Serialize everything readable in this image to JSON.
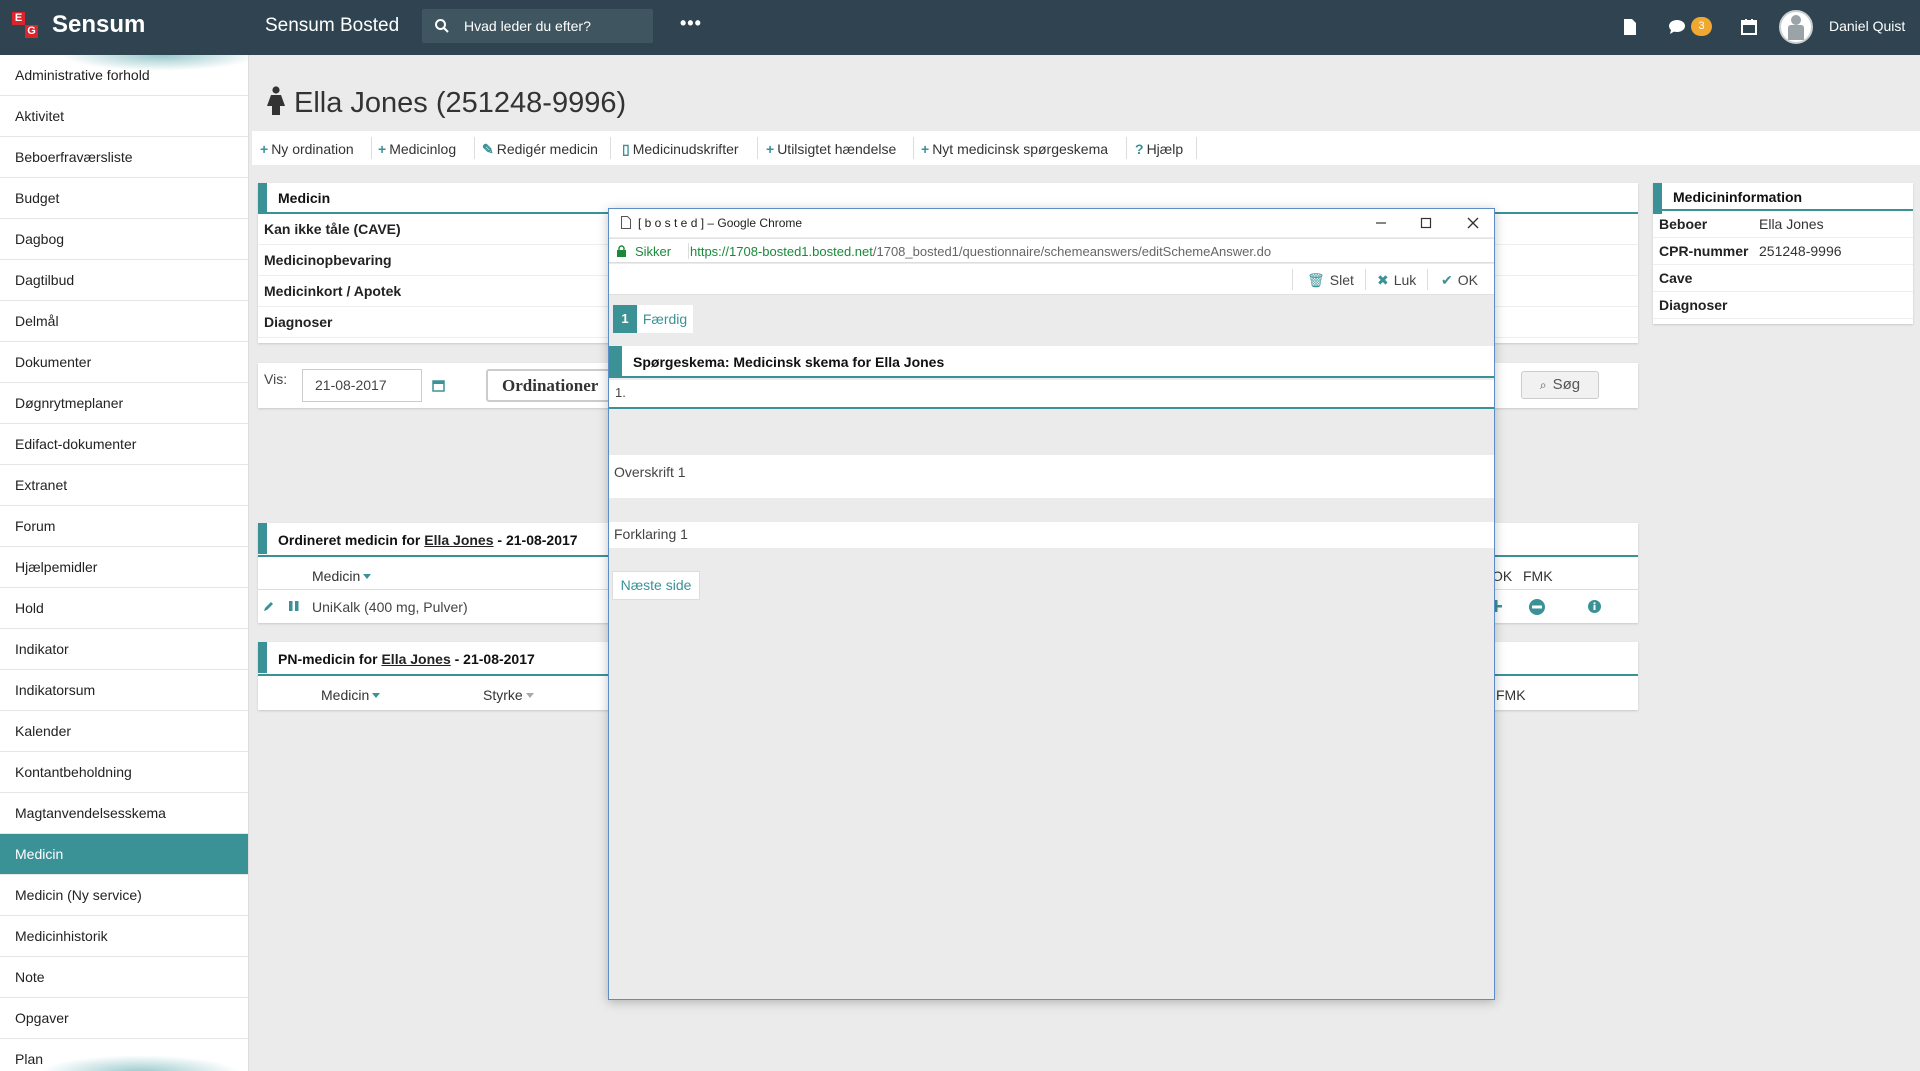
{
  "topbar": {
    "brand": "Sensum",
    "logo_letters": [
      "E",
      "G"
    ],
    "app_title": "Sensum Bosted",
    "search_placeholder": "Hvad leder du efter?",
    "more": "•••",
    "messages_badge": "3",
    "user_name": "Daniel Quist"
  },
  "sidebar": {
    "items": [
      "Administrative forhold",
      "Aktivitet",
      "Beboerfraværsliste",
      "Budget",
      "Dagbog",
      "Dagtilbud",
      "Delmål",
      "Dokumenter",
      "Døgnrytmeplaner",
      "Edifact-dokumenter",
      "Extranet",
      "Forum",
      "Hjælpemidler",
      "Hold",
      "Indikator",
      "Indikatorsum",
      "Kalender",
      "Kontantbeholdning",
      "Magtanvendelsesskema",
      "Medicin",
      "Medicin (Ny service)",
      "Medicinhistorik",
      "Note",
      "Opgaver",
      "Plan"
    ],
    "active_index": 19
  },
  "page": {
    "title": "Ella Jones (251248-9996)"
  },
  "actions": [
    {
      "icon": "+",
      "label": "Ny ordination"
    },
    {
      "icon": "+",
      "label": "Medicinlog"
    },
    {
      "icon": "✎",
      "label": "Redigér medicin"
    },
    {
      "icon": "▯",
      "label": "Medicinudskrifter"
    },
    {
      "icon": "+",
      "label": "Utilsigtet hændelse"
    },
    {
      "icon": "+",
      "label": "Nyt medicinsk spørgeskema"
    },
    {
      "icon": "?",
      "label": "Hjælp"
    }
  ],
  "medicin_panel": {
    "title": "Medicin",
    "rows": [
      "Kan ikke tåle (CAVE)",
      "Medicinopbevaring",
      "Medicinkort / Apotek",
      "Diagnoser"
    ]
  },
  "filter": {
    "vis_label": "Vis:",
    "date": "21-08-2017",
    "ordination_button": "Ordinationer",
    "search_button": "Søg"
  },
  "ordineret": {
    "title_prefix": "Ordineret medicin for",
    "person": "Ella Jones",
    "title_suffix": "- 21-08-2017",
    "col_medicin": "Medicin",
    "col_ok": "OK",
    "col_fmk": "FMK",
    "row_medicin": "UniKalk (400 mg, Pulver)"
  },
  "pn": {
    "title_prefix": "PN-medicin for",
    "person": "Ella Jones",
    "title_suffix": "- 21-08-2017",
    "col_medicin": "Medicin",
    "col_styrke": "Styrke",
    "col_fmk": "FMK"
  },
  "info_panel": {
    "title": "Medicininformation",
    "rows": [
      {
        "k": "Beboer",
        "v": "Ella Jones"
      },
      {
        "k": "CPR-nummer",
        "v": "251248-9996"
      },
      {
        "k": "Cave",
        "v": ""
      },
      {
        "k": "Diagnoser",
        "v": ""
      }
    ]
  },
  "popup": {
    "window_title": "[ b o s t e d ] – Google Chrome",
    "secure_label": "Sikker",
    "url_scheme": "https://",
    "url_host": "1708-bosted1.bosted.net",
    "url_path": "/1708_bosted1/questionnaire/schemeanswers/editSchemeAnswer.do",
    "toolbar": {
      "delete": "Slet",
      "close": "Luk",
      "ok": "OK"
    },
    "step_number": "1",
    "step_label": "Færdig",
    "questionnaire_title": "Spørgeskema: Medicinsk skema for Ella Jones",
    "question_number": "1.",
    "heading": "Overskrift 1",
    "explanation": "Forklaring 1",
    "next_button": "Næste side"
  },
  "colors": {
    "topbar": "#2f4450",
    "accent": "#3a9297",
    "badge": "#f0a830",
    "logo": "#d9262e"
  }
}
